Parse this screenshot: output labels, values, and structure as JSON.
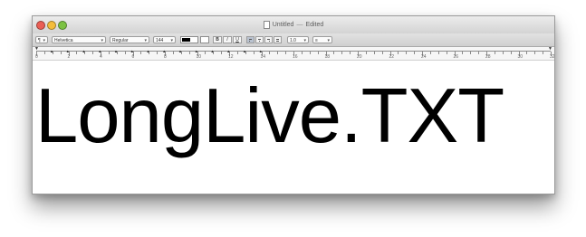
{
  "window": {
    "title": "Untitled",
    "title_suffix": "Edited"
  },
  "toolbar": {
    "style_menu_label": "¶",
    "font_family": "Helvetica",
    "font_style": "Regular",
    "font_size": "144",
    "bold_label": "B",
    "italic_label": "I",
    "underline_label": "U",
    "line_spacing": "1.0",
    "list_menu_label": "≡"
  },
  "ruler": {
    "numbers": [
      "0",
      "2",
      "4",
      "6",
      "8",
      "10",
      "12",
      "14",
      "16",
      "18",
      "20",
      "22",
      "24",
      "26",
      "28",
      "30",
      "32"
    ]
  },
  "document": {
    "text": "LongLive.TXT"
  },
  "colors": {
    "text": "#000000",
    "close": "#ea5e55",
    "minimize": "#f4bd3c",
    "zoom": "#7cc243"
  }
}
